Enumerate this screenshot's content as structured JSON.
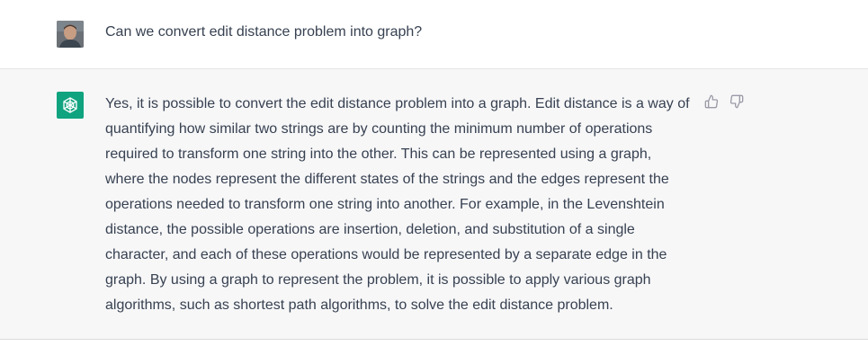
{
  "conversation": {
    "user_message": {
      "avatar_icon": "user-photo-avatar",
      "text": "Can we convert edit distance problem into graph?"
    },
    "assistant_message": {
      "avatar_icon": "openai-logo-icon",
      "accent_color": "#10a37f",
      "lines": [
        "Yes, it is possible to convert the edit distance problem into a graph. Edit distance is a way of",
        "quantifying how similar two strings are by counting the minimum number of operations",
        "required to transform one string into the other. This can be represented using a graph,",
        "where the nodes represent the different states of the strings and the edges represent the",
        "operations needed to transform one string into another. For example, in the Levenshtein",
        "distance, the possible operations are insertion, deletion, and substitution of a single",
        "character, and each of these operations would be represented by a separate edge in the",
        "graph. By using a graph to represent the problem, it is possible to apply various graph",
        "algorithms, such as shortest path algorithms, to solve the edit distance problem."
      ],
      "actions": [
        "thumbs-up-icon",
        "thumbs-down-icon"
      ]
    }
  }
}
